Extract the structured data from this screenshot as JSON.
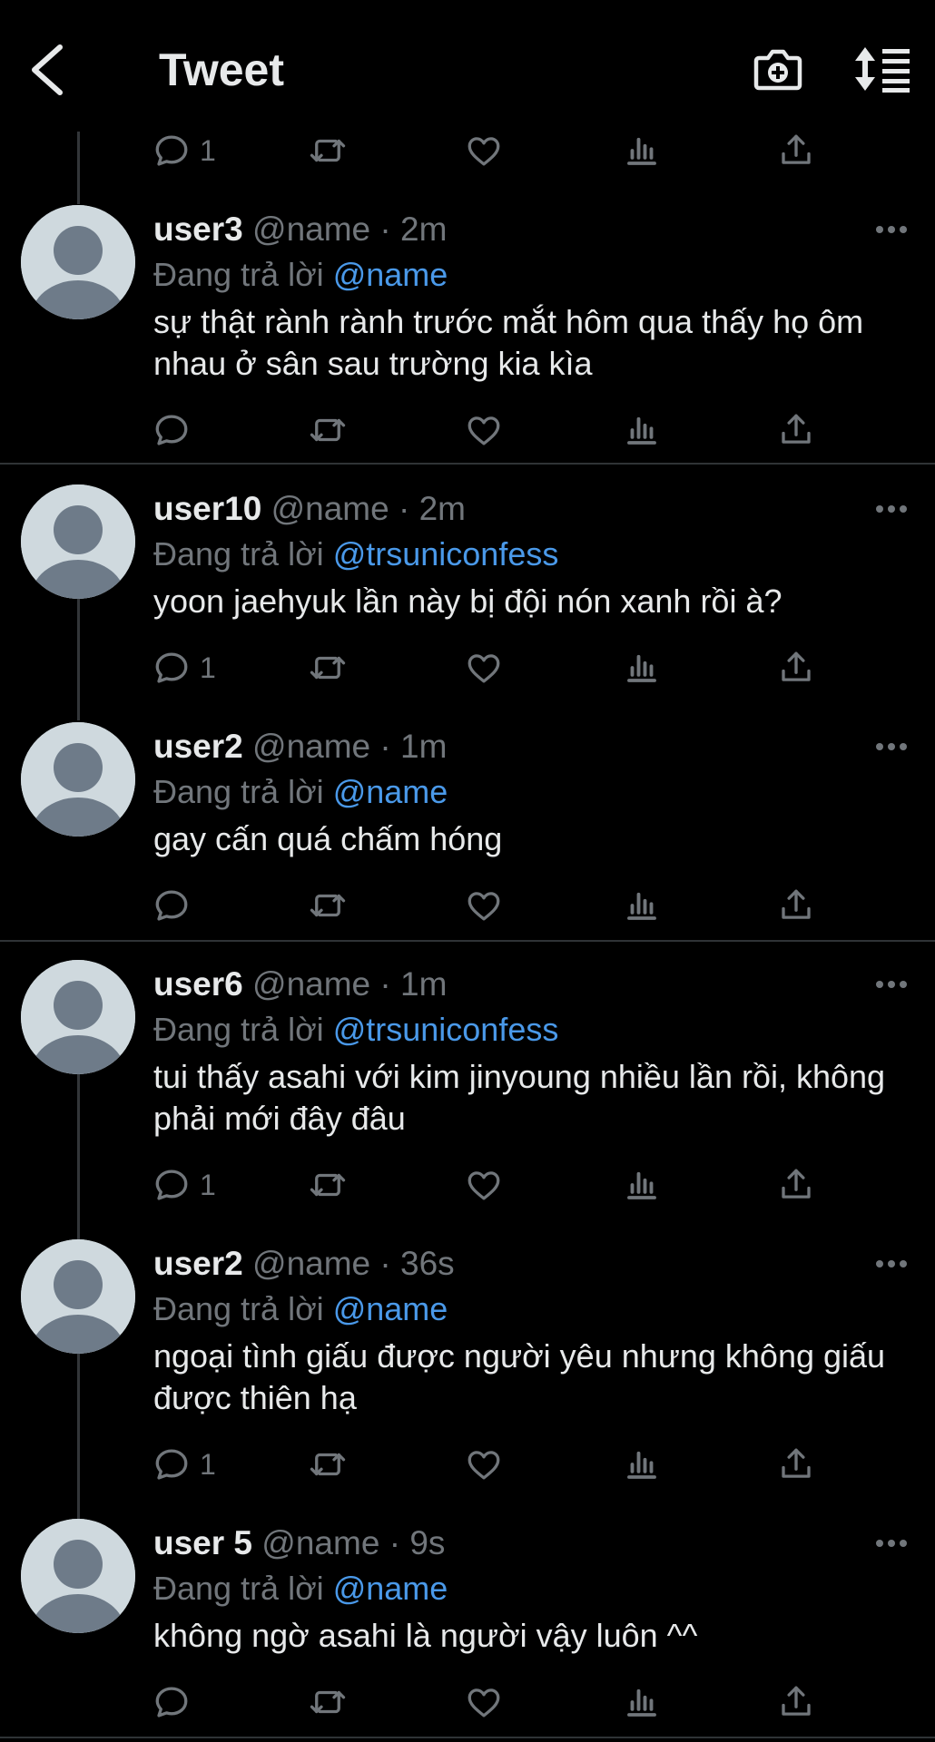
{
  "header": {
    "title": "Tweet"
  },
  "top_actions": {
    "reply_count": "1"
  },
  "tweets": [
    {
      "username": "user3",
      "handle": "@name",
      "time": "2m",
      "reply_prefix": "Đang trả lời",
      "reply_to": "@name",
      "text": "sự thật rành rành trước mắt hôm qua thấy họ ôm nhau ở sân sau trường kia kìa",
      "reply_count": ""
    },
    {
      "username": "user10",
      "handle": "@name",
      "time": "2m",
      "reply_prefix": "Đang trả lời",
      "reply_to": "@trsuniconfess",
      "text": "yoon jaehyuk lần này bị đội nón xanh rồi à?",
      "reply_count": "1"
    },
    {
      "username": "user2",
      "handle": "@name",
      "time": "1m",
      "reply_prefix": "Đang trả lời",
      "reply_to": "@name",
      "text": "gay cấn quá chấm hóng",
      "reply_count": ""
    },
    {
      "username": "user6",
      "handle": "@name",
      "time": "1m",
      "reply_prefix": "Đang trả lời",
      "reply_to": "@trsuniconfess",
      "text": "tui thấy asahi với kim jinyoung nhiều lần rồi, không phải mới đây đâu",
      "reply_count": "1"
    },
    {
      "username": "user2",
      "handle": "@name",
      "time": "36s",
      "reply_prefix": "Đang trả lời",
      "reply_to": "@name",
      "text": "ngoại tình giấu được người yêu nhưng không giấu được thiên hạ",
      "reply_count": "1"
    },
    {
      "username": "user 5",
      "handle": "@name",
      "time": "9s",
      "reply_prefix": "Đang trả lời",
      "reply_to": "@name",
      "text": "không ngờ asahi là người vậy luôn ^^",
      "reply_count": ""
    }
  ],
  "colors": {
    "background": "#000000",
    "text": "#e7e9ea",
    "secondary": "#71767b",
    "link": "#4a99e9",
    "avatar": "#cfd9de"
  }
}
